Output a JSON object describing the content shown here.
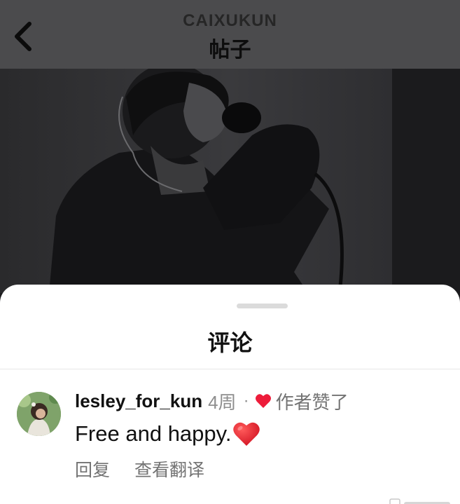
{
  "header": {
    "username": "CAIXUKUN",
    "title": "帖子",
    "back_icon": "chevron-left-icon"
  },
  "post": {
    "media_icon": "post-photo"
  },
  "comments_sheet": {
    "title": "评论",
    "comments": [
      {
        "username": "lesley_for_kun",
        "time": "4周",
        "separator": "·",
        "liked_by_author_label": "作者赞了",
        "text": "Free and happy.",
        "emoji": "red-heart-icon",
        "reply_label": "回复",
        "translate_label": "查看翻译"
      }
    ]
  },
  "colors": {
    "heart": "#ed1c3a",
    "secondary_text": "#737373",
    "primary_text": "#111111"
  }
}
